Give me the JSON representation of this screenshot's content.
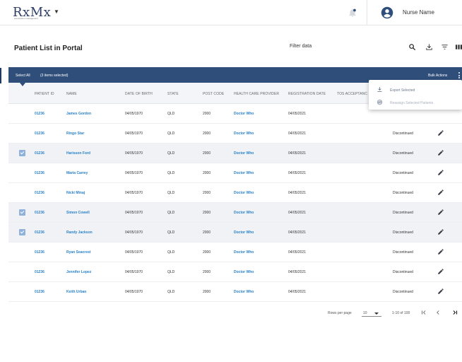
{
  "header": {
    "logo": "RxMx",
    "logo_tagline": "prescription management",
    "user_name": "Nurse Name",
    "bell_icon": "bell-icon",
    "avatar_icon": "account-circle-icon"
  },
  "toolbar": {
    "title": "Patient List in Portal",
    "filter_label": "Filter data",
    "icons": [
      "search-icon",
      "download-icon",
      "filter-icon",
      "columns-icon"
    ]
  },
  "selection_bar": {
    "select_all": "Select All",
    "selected_count": "(3 items selected)",
    "bulk_actions": "Bulk Actions"
  },
  "bulk_menu": {
    "items": [
      {
        "label": "Export Selected",
        "icon": "download-icon"
      },
      {
        "label": "Reassign Selected Patients",
        "icon": "reassign-icon"
      }
    ]
  },
  "table": {
    "columns": [
      "PATIENT ID",
      "NAME",
      "DATE OF BIRTH",
      "STATE",
      "POST CODE",
      "HEALTH CARE PROVIDER",
      "REGISTRATION DATE",
      "TOS ACCEPTANC"
    ],
    "rows": [
      {
        "id": "01236",
        "name": "James Gordon",
        "dob": "04/05/1970",
        "state": "QLD",
        "post": "2000",
        "provider": "Doctor Who",
        "reg": "04/05/2021",
        "status": "",
        "selected": false
      },
      {
        "id": "01236",
        "name": "Ringo Star",
        "dob": "04/05/1970",
        "state": "QLD",
        "post": "2000",
        "provider": "Doctor Who",
        "reg": "04/05/2021",
        "status": "Discontinued",
        "selected": false
      },
      {
        "id": "01236",
        "name": "Harisson Ford",
        "dob": "04/05/1970",
        "state": "QLD",
        "post": "2000",
        "provider": "Doctor Who",
        "reg": "04/05/2021",
        "status": "Discontinued",
        "selected": true
      },
      {
        "id": "01236",
        "name": "Maria Carrey",
        "dob": "04/05/1970",
        "state": "QLD",
        "post": "2000",
        "provider": "Doctor Who",
        "reg": "04/05/2021",
        "status": "Discontinued",
        "selected": false
      },
      {
        "id": "01236",
        "name": "Nicki Minaj",
        "dob": "04/05/1970",
        "state": "QLD",
        "post": "2000",
        "provider": "Doctor Who",
        "reg": "04/05/2021",
        "status": "Discontinued",
        "selected": false
      },
      {
        "id": "01236",
        "name": "Simon Cowell",
        "dob": "04/05/1970",
        "state": "QLD",
        "post": "2000",
        "provider": "Doctor Who",
        "reg": "04/05/2021",
        "status": "Discontinued",
        "selected": true
      },
      {
        "id": "01236",
        "name": "Randy Jackson",
        "dob": "04/05/1970",
        "state": "QLD",
        "post": "2000",
        "provider": "Doctor Who",
        "reg": "04/05/2021",
        "status": "Discontinued",
        "selected": true
      },
      {
        "id": "01236",
        "name": "Ryan Seacrest",
        "dob": "04/05/1970",
        "state": "QLD",
        "post": "2000",
        "provider": "Doctor Who",
        "reg": "04/05/2021",
        "status": "Discontinued",
        "selected": false
      },
      {
        "id": "01236",
        "name": "Jennifer Lopez",
        "dob": "04/05/1970",
        "state": "QLD",
        "post": "2000",
        "provider": "Doctor Who",
        "reg": "04/05/2021",
        "status": "Discontinued",
        "selected": false
      },
      {
        "id": "01236",
        "name": "Keith Urban",
        "dob": "04/05/1970",
        "state": "QLD",
        "post": "2000",
        "provider": "Doctor Who",
        "reg": "04/05/2021",
        "status": "Discontinued",
        "selected": false
      }
    ]
  },
  "pagination": {
    "rows_per_page_label": "Rows per page",
    "rows_per_page": "10",
    "range": "1-10 of 100"
  },
  "colors": {
    "selection_bar": "#2f4f7a",
    "link": "#2a82c9",
    "checkbox": "#8fb1da"
  }
}
